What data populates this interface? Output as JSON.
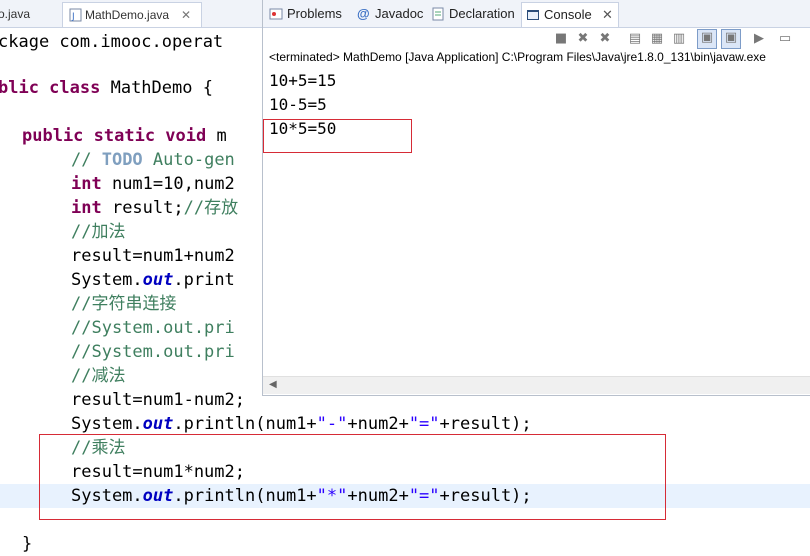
{
  "editor": {
    "tabs": {
      "prev_label": "o.java",
      "active_label": "MathDemo.java",
      "close_label": "✕"
    },
    "lines": {
      "l1": {
        "a": "ckage com.imooc.operat"
      },
      "l2": {
        "kw": "blic class ",
        "rest": "MathDemo {"
      },
      "l3": {
        "kw": "public static void ",
        "rest": "m"
      },
      "l4": {
        "cm": "// ",
        "todo": "TODO",
        "cm2": " Auto-gen"
      },
      "l5": {
        "kw": "int ",
        "rest": "num1=10,num2"
      },
      "l6": {
        "kw": "int ",
        "rest": "result;",
        "cm": "//存放"
      },
      "l7": {
        "cm": "//加法"
      },
      "l8": {
        "rest": "result=num1+num2"
      },
      "l9": {
        "a": "System.",
        "fld": "out",
        "b": ".print"
      },
      "l10": {
        "cm": "//字符串连接"
      },
      "l11": {
        "cm": "//System.out.pri"
      },
      "l12": {
        "cm": "//System.out.pri"
      },
      "l13": {
        "cm": "//减法"
      },
      "l14": {
        "rest": "result=num1-num2;"
      },
      "l15": {
        "a": "System.",
        "fld": "out",
        "b": ".println(num1+",
        "s1": "\"-\"",
        "c": "+num2+",
        "s2": "\"=\"",
        "d": "+result);"
      },
      "l16": {
        "cm": "//乘法"
      },
      "l17": {
        "rest": "result=num1*num2;"
      },
      "l18": {
        "a": "System.",
        "fld": "out",
        "b": ".println(num1+",
        "s1": "\"*\"",
        "c": "+num2+",
        "s2": "\"=\"",
        "d": "+result);"
      },
      "l19": {
        "a": "}"
      }
    }
  },
  "console": {
    "tabs": {
      "problems": "Problems",
      "javadoc": "Javadoc",
      "declaration": "Declaration",
      "console": "Console",
      "close": "✕"
    },
    "status": "<terminated> MathDemo [Java Application] C:\\Program Files\\Java\\jre1.8.0_131\\bin\\javaw.exe",
    "output": [
      "10+5=15",
      "10-5=5",
      "10*5=50"
    ]
  },
  "colors": {
    "highlight_box": "#d62b36",
    "keyword": "#7f0055",
    "comment": "#3f7f5f",
    "string": "#2a00ff",
    "field": "#0000c0"
  }
}
